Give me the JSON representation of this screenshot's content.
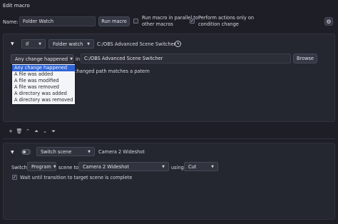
{
  "window": {
    "title": "Edit macro"
  },
  "header": {
    "name_label": "Name:",
    "name_value": "Folder Watch",
    "run_button": "Run macro",
    "parallel_label": "Run macro in parallel to other macros",
    "parallel_line1": "Run macro in parallel to",
    "parallel_line2": "other macros",
    "parallel_checked": false,
    "only_on_change_line1": "Perform actions only on",
    "only_on_change_line2": "condition change",
    "only_on_change_checked": true,
    "settings_icon": "gear-icon"
  },
  "condition": {
    "logic": "If",
    "type": "Folder watch",
    "path_text": "C:/OBS Advanced Scene Switcher",
    "change_type": "Any change happened",
    "in_label": "in",
    "path_value": "C:/OBS Advanced Scene Switcher",
    "browse_button": "Browse",
    "partial_text": "changed path matches a patern",
    "dropdown_options": [
      "Any change happened",
      "A file was added",
      "A file was modified",
      "A file was removed",
      "A directory was added",
      "A directory was removed"
    ],
    "selected_option": "Any change happened"
  },
  "toolbar": {
    "icons": [
      "plus-icon",
      "trash-icon",
      "move-up-icon",
      "move-top-icon",
      "move-down-icon",
      "move-bottom-icon"
    ],
    "glyphs": [
      "+",
      "🗑",
      "⌃",
      "⏶",
      "⌄",
      "⏷"
    ]
  },
  "action": {
    "type": "Switch scene",
    "scene_name": "Camera 2 Wideshot",
    "switch_label": "Switch",
    "switch_target": "Program",
    "scene_to_label": "scene to",
    "scene_value": "Camera 2 Wideshot",
    "using_label": "using",
    "transition_value": "Cut",
    "wait_label": "Wait until transition to target scene is complete",
    "wait_checked": true
  }
}
